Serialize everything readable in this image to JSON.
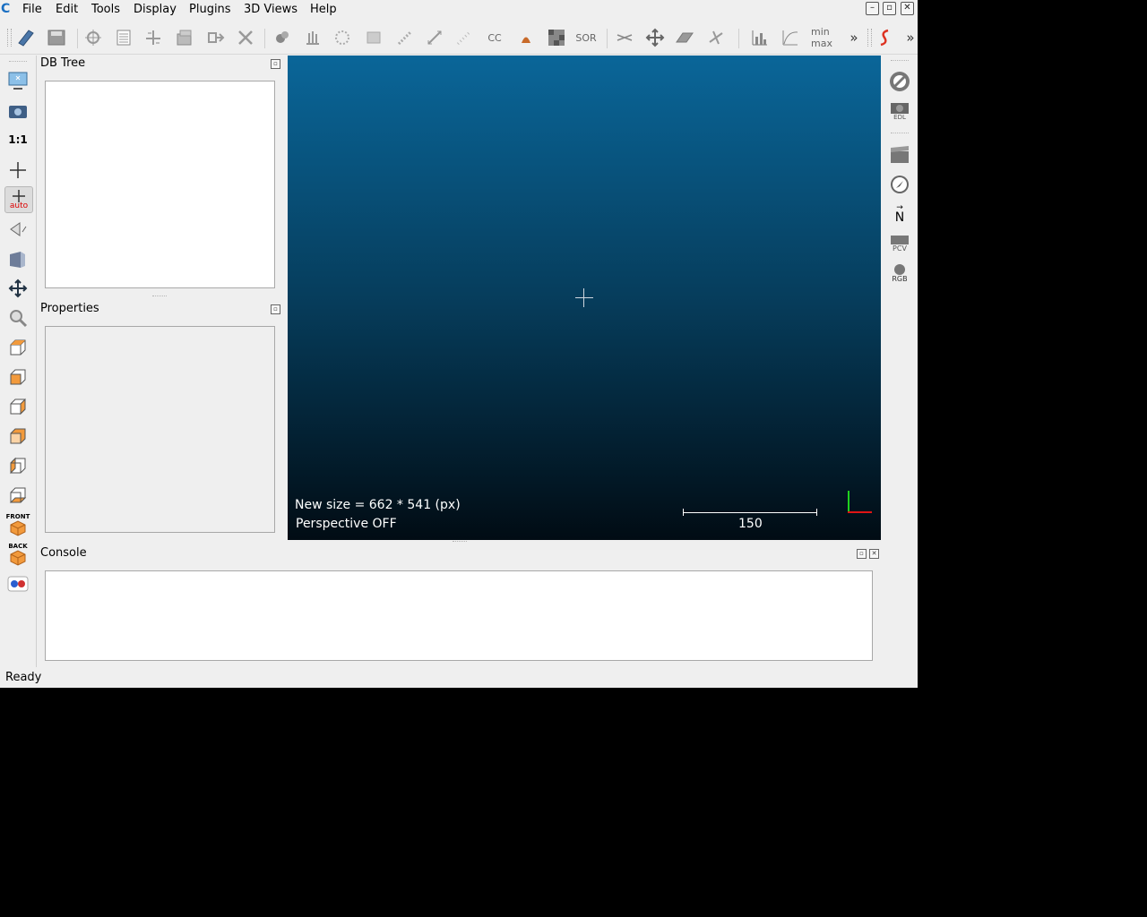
{
  "menu": [
    "File",
    "Edit",
    "Tools",
    "Display",
    "Plugins",
    "3D Views",
    "Help"
  ],
  "app_logo_text": "C",
  "window_controls": {
    "minimize": "–",
    "restore": "▫",
    "close": "✕"
  },
  "toolbar": {
    "overflow_1": "»",
    "overflow_2": "»",
    "sor_label": "SOR",
    "cc_label": "CC",
    "minmax_label": "min max"
  },
  "left_toolbar": {
    "one_to_one": "1:1",
    "auto_label": "auto",
    "front_label": "FRONT",
    "back_label": "BACK"
  },
  "right_toolbar": {
    "edl_label": "EDL",
    "north_label": "N",
    "pcv_label": "PCV",
    "rgb_label": "RGB"
  },
  "docks": {
    "db_tree_title": "DB Tree",
    "properties_title": "Properties",
    "console_title": "Console"
  },
  "view3d": {
    "size_message": "New size = 662 * 541 (px)",
    "perspective_message": "Perspective OFF",
    "scale_value": "150",
    "background_top": "#0a6699",
    "background_bottom": "#010c14"
  },
  "status": {
    "text": "Ready"
  }
}
